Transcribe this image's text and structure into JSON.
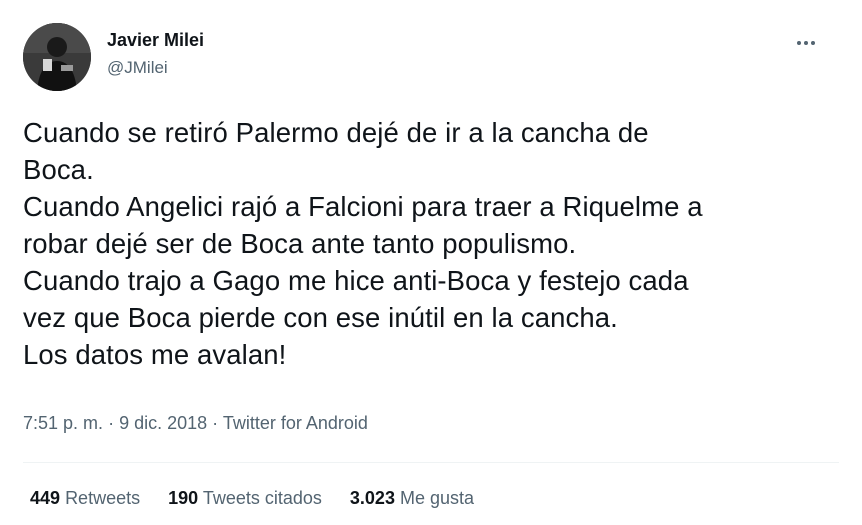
{
  "author": {
    "name": "Javier Milei",
    "handle": "@JMilei"
  },
  "tweet": {
    "lines": [
      "Cuando se retiró Palermo dejé de ir a la cancha de",
      "Boca.",
      "Cuando Angelici rajó a Falcioni para traer a Riquelme a",
      "robar dejé ser de Boca ante tanto populismo.",
      "Cuando trajo a Gago me hice anti-Boca y festejo cada",
      "vez que Boca pierde con ese inútil en la cancha.",
      "Los datos me avalan!"
    ]
  },
  "meta": {
    "time": "7:51 p. m.",
    "separator": "·",
    "date": "9 dic. 2018",
    "source": "Twitter for Android"
  },
  "stats": {
    "retweets": {
      "count": "449",
      "label": "Retweets"
    },
    "quotes": {
      "count": "190",
      "label": "Tweets citados"
    },
    "likes": {
      "count": "3.023",
      "label": "Me gusta"
    }
  },
  "icons": {
    "more": "more-horizontal-icon",
    "avatar": "profile-photo"
  },
  "colors": {
    "text_primary": "#0f1419",
    "text_secondary": "#536471",
    "divider": "#eff3f4"
  }
}
